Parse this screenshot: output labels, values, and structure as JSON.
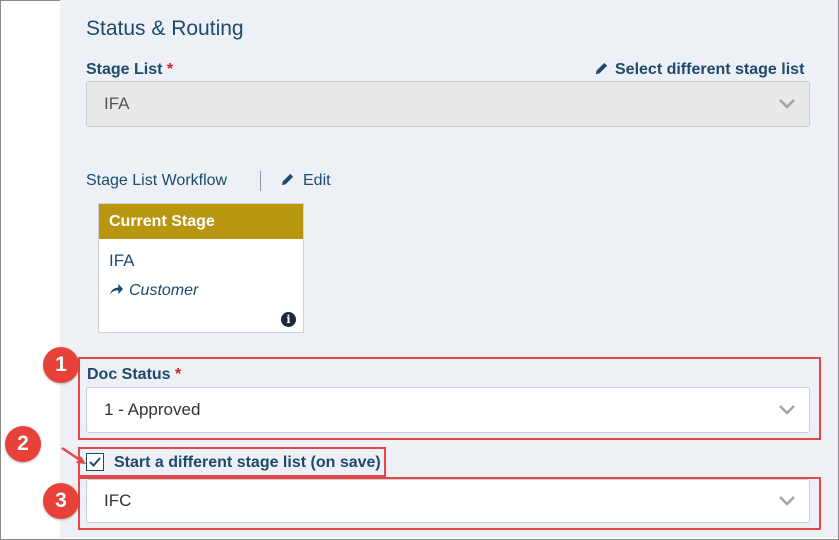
{
  "section": {
    "title": "Status & Routing"
  },
  "stage_list": {
    "label": "Stage List",
    "required_mark": "*",
    "value": "IFA",
    "select_link": "Select different stage list"
  },
  "workflow": {
    "label": "Stage List Workflow",
    "edit_label": "Edit",
    "card": {
      "header": "Current Stage",
      "stage": "IFA",
      "route": "Customer"
    }
  },
  "doc_status": {
    "label": "Doc Status",
    "required_mark": "*",
    "value": "1 - Approved"
  },
  "different_stage": {
    "checkbox_label": "Start a different stage list (on save)",
    "checked": true,
    "value": "IFC"
  },
  "annotations": [
    "1",
    "2",
    "3"
  ],
  "colors": {
    "accent": "#1d4a6e",
    "stage_header": "#b8960f",
    "highlight": "#e34848",
    "required": "#d0202a"
  }
}
